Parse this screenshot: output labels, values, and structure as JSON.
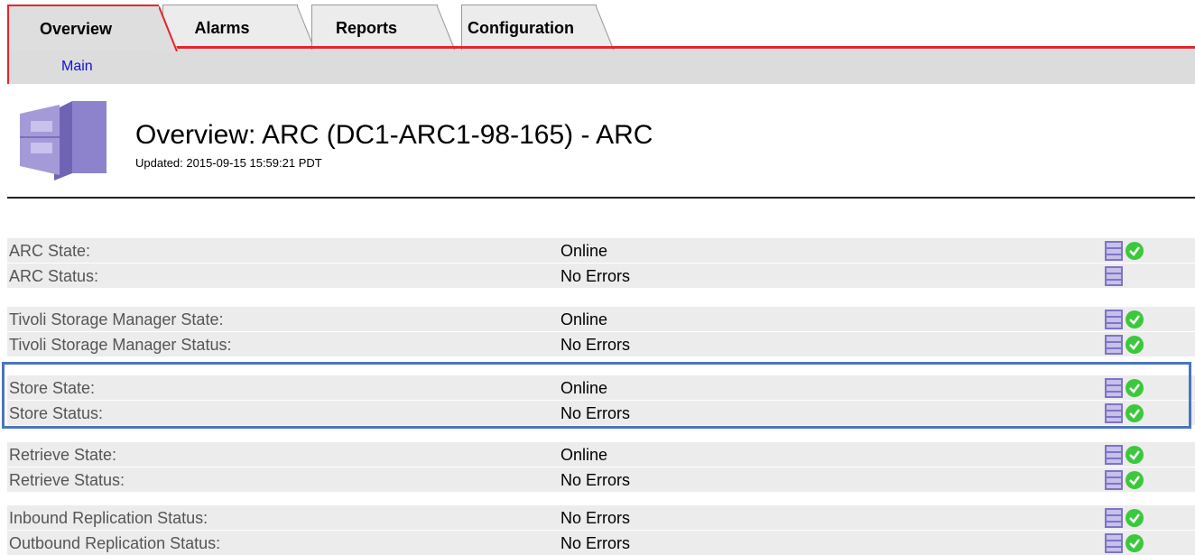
{
  "tabs": [
    {
      "label": "Overview",
      "active": true
    },
    {
      "label": "Alarms",
      "active": false
    },
    {
      "label": "Reports",
      "active": false
    },
    {
      "label": "Configuration",
      "active": false
    }
  ],
  "subnav": {
    "main_link": "Main"
  },
  "header": {
    "title": "Overview: ARC (DC1-ARC1-98-165) - ARC",
    "updated": "Updated: 2015-09-15 15:59:21 PDT"
  },
  "rows": [
    {
      "label": "ARC State:",
      "value": "Online",
      "status_ok": true
    },
    {
      "label": "ARC Status:",
      "value": "No Errors",
      "status_ok": false
    },
    {
      "label": "Tivoli Storage Manager State:",
      "value": "Online",
      "status_ok": true
    },
    {
      "label": "Tivoli Storage Manager Status:",
      "value": "No Errors",
      "status_ok": true
    },
    {
      "label": "Store State:",
      "value": "Online",
      "status_ok": true
    },
    {
      "label": "Store Status:",
      "value": "No Errors",
      "status_ok": true
    },
    {
      "label": "Retrieve State:",
      "value": "Online",
      "status_ok": true
    },
    {
      "label": "Retrieve Status:",
      "value": "No Errors",
      "status_ok": true
    },
    {
      "label": "Inbound Replication Status:",
      "value": "No Errors",
      "status_ok": true
    },
    {
      "label": "Outbound Replication Status:",
      "value": "No Errors",
      "status_ok": true
    }
  ],
  "icons": {
    "chart": "chart-icon",
    "ok": "check-circle-icon",
    "header": "server-icon"
  },
  "colors": {
    "tab_accent": "#e8242c",
    "link": "#1010d8",
    "highlight_border": "#4a74c0",
    "ok_green": "#3cc83c",
    "row_bg": "#ececec"
  }
}
